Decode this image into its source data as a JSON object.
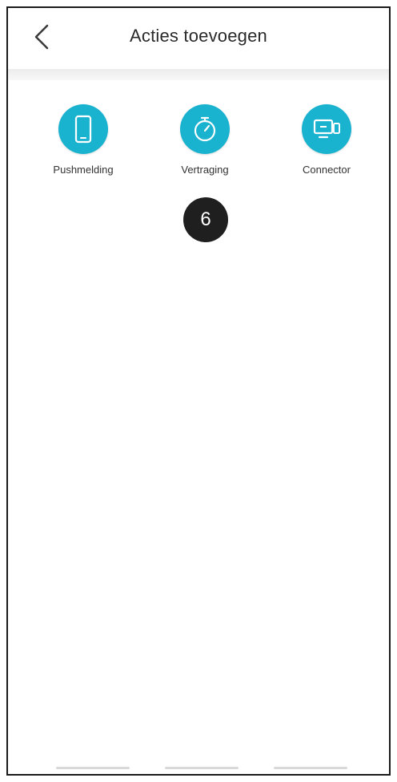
{
  "header": {
    "title": "Acties toevoegen",
    "back_icon": "chevron-left-icon"
  },
  "actions": [
    {
      "label": "Pushmelding",
      "icon": "phone-icon"
    },
    {
      "label": "Vertraging",
      "icon": "stopwatch-icon"
    },
    {
      "label": "Connector",
      "icon": "connector-icon"
    }
  ],
  "step_badge": "6",
  "colors": {
    "accent": "#19b2cf",
    "badge": "#1f1f1f",
    "text": "#2a2a2a"
  }
}
